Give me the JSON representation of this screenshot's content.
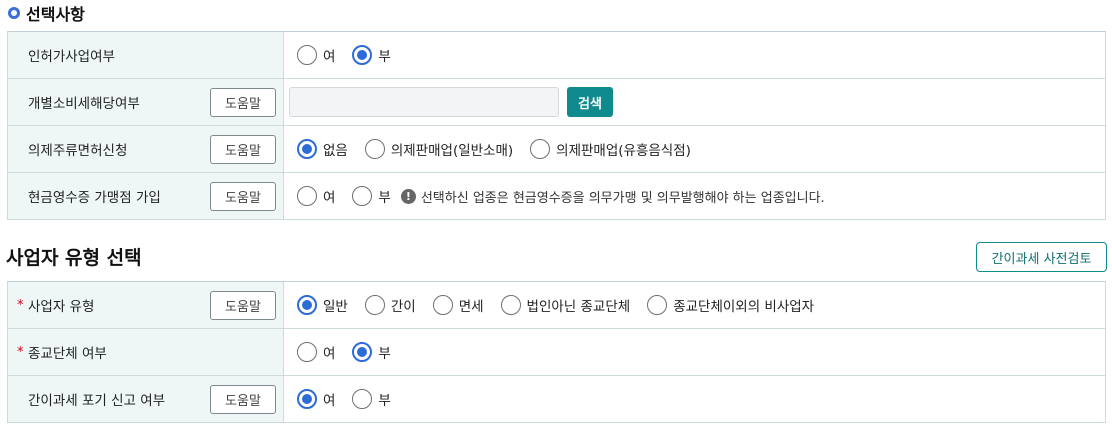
{
  "section1": {
    "title": "선택사항",
    "rows": [
      {
        "label": "인허가사업여부",
        "options": [
          "여",
          "부"
        ]
      },
      {
        "label": "개별소비세해당여부",
        "help": "도움말",
        "search_button": "검색"
      },
      {
        "label": "의제주류면허신청",
        "help": "도움말",
        "options": [
          "없음",
          "의제판매업(일반소매)",
          "의제판매업(유흥음식점)"
        ]
      },
      {
        "label": "현금영수증 가맹점 가입",
        "help": "도움말",
        "options": [
          "여",
          "부"
        ],
        "info": "선택하신 업종은 현금영수증을 의무가맹 및 의무발행해야 하는 업종입니다."
      }
    ]
  },
  "section2": {
    "title": "사업자 유형 선택",
    "prereview_button": "간이과세 사전검토",
    "rows": [
      {
        "label": "사업자 유형",
        "required_mark": "*",
        "help": "도움말",
        "options": [
          "일반",
          "간이",
          "면세",
          "법인아닌 종교단체",
          "종교단체이외의 비사업자"
        ]
      },
      {
        "label": "종교단체 여부",
        "required_mark": "*",
        "options": [
          "여",
          "부"
        ]
      },
      {
        "label": "간이과세 포기 신고 여부",
        "help": "도움말",
        "options": [
          "여",
          "부"
        ]
      }
    ]
  },
  "selected": {
    "인허가사업여부": "부",
    "의제주류면허신청": "없음",
    "현금영수증 가맹점 가입": "none",
    "사업자 유형": "일반",
    "종교단체 여부": "부",
    "간이과세 포기 신고 여부": "여"
  },
  "icons": {
    "section_bullet": "circle-bullet-icon",
    "info": "info-icon",
    "required": "asterisk"
  },
  "colors": {
    "accent_blue": "#2d6bd6",
    "teal_button": "#0f8a8d",
    "header_bg": "#eef7f6",
    "required_red": "#d0021b"
  }
}
